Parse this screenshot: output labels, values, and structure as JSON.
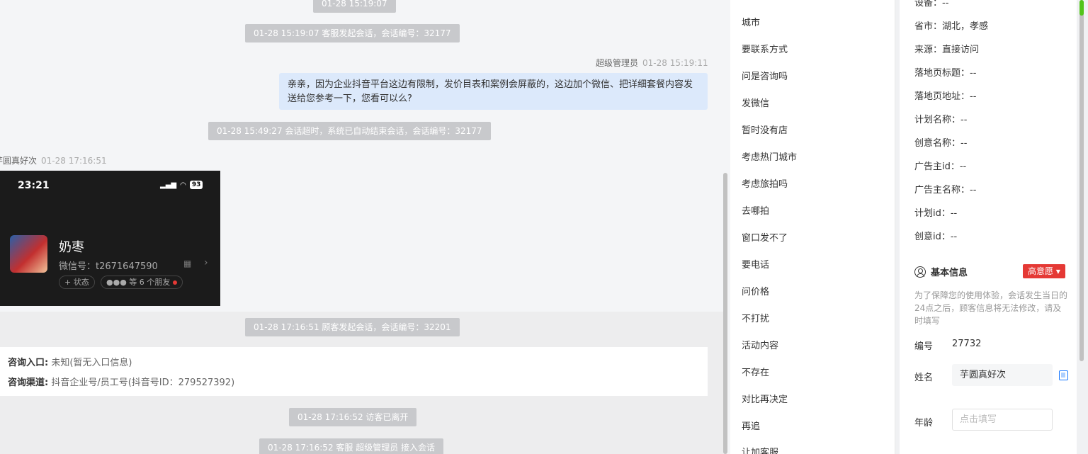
{
  "chat": {
    "sys_top_time": "01-28 15:19:07",
    "sys_agent_start": "01-28 15:19:07 客服发起会话，会话编号：32177",
    "agent_name": "超级管理员",
    "agent_time": "01-28 15:19:11",
    "agent_message": "亲亲，因为企业抖音平台这边有限制，发价目表和案例会屏蔽的，这边加个微信、把详细套餐内容发送给您参考一下，您看可以么?",
    "sys_timeout": "01-28 15:49:27 会话超时，系统已自动结束会话，会话编号：32177",
    "visitor_name": "芋圆真好次",
    "visitor_time": "01-28 17:16:51",
    "screenshot": {
      "clock": "23:21",
      "battery": "93",
      "wechat_name": "奶枣",
      "wechat_id": "微信号：t2671647590",
      "status_tag": "+ 状态",
      "friends_tag": "等 6 个朋友"
    },
    "sys_visitor_start": "01-28 17:16:51 顾客发起会话，会话编号：32201",
    "entry_label": "咨询入口:",
    "entry_value": "未知(暂无入口信息)",
    "channel_label": "咨询渠道:",
    "channel_value": "抖音企业号/员工号(抖音号ID：279527392)",
    "sys_left": "01-28 17:16:52 访客已离开",
    "sys_join": "01-28 17:16:52 客服 超级管理员 接入会话"
  },
  "quick_replies": [
    "城市",
    "要联系方式",
    "问是咨询吗",
    "发微信",
    "暂时没有店",
    "考虑热门城市",
    "考虑旅拍吗",
    "去哪拍",
    "窗口发不了",
    "要电话",
    "问价格",
    "不打扰",
    "活动内容",
    "不存在",
    "对比再决定",
    "再追",
    "让加客服"
  ],
  "customer": {
    "device": "设备：--",
    "province_city": "省市：湖北，孝感",
    "source": "来源：直接访问",
    "landing_title": "落地页标题：--",
    "landing_url": "落地页地址：--",
    "plan_name": "计划名称：--",
    "creative_name": "创意名称：--",
    "advertiser_id": "广告主id：--",
    "advertiser_name": "广告主名称：--",
    "plan_id": "计划id：--",
    "creative_id": "创意id：--",
    "basic_info_title": "基本信息",
    "intent_badge": "高意愿",
    "hint": "为了保障您的使用体验，会话发生当日的24点之后，顾客信息将无法修改，请及时填写",
    "number_label": "编号",
    "number_value": "27732",
    "name_label": "姓名",
    "name_value": "芋圆真好次",
    "age_label": "年龄",
    "age_placeholder": "点击填写"
  },
  "colors": {
    "accent": "#1677ff",
    "badge": "#e53935",
    "agent_bubble": "#dce9fb",
    "system_pill": "#c8c9cc"
  }
}
